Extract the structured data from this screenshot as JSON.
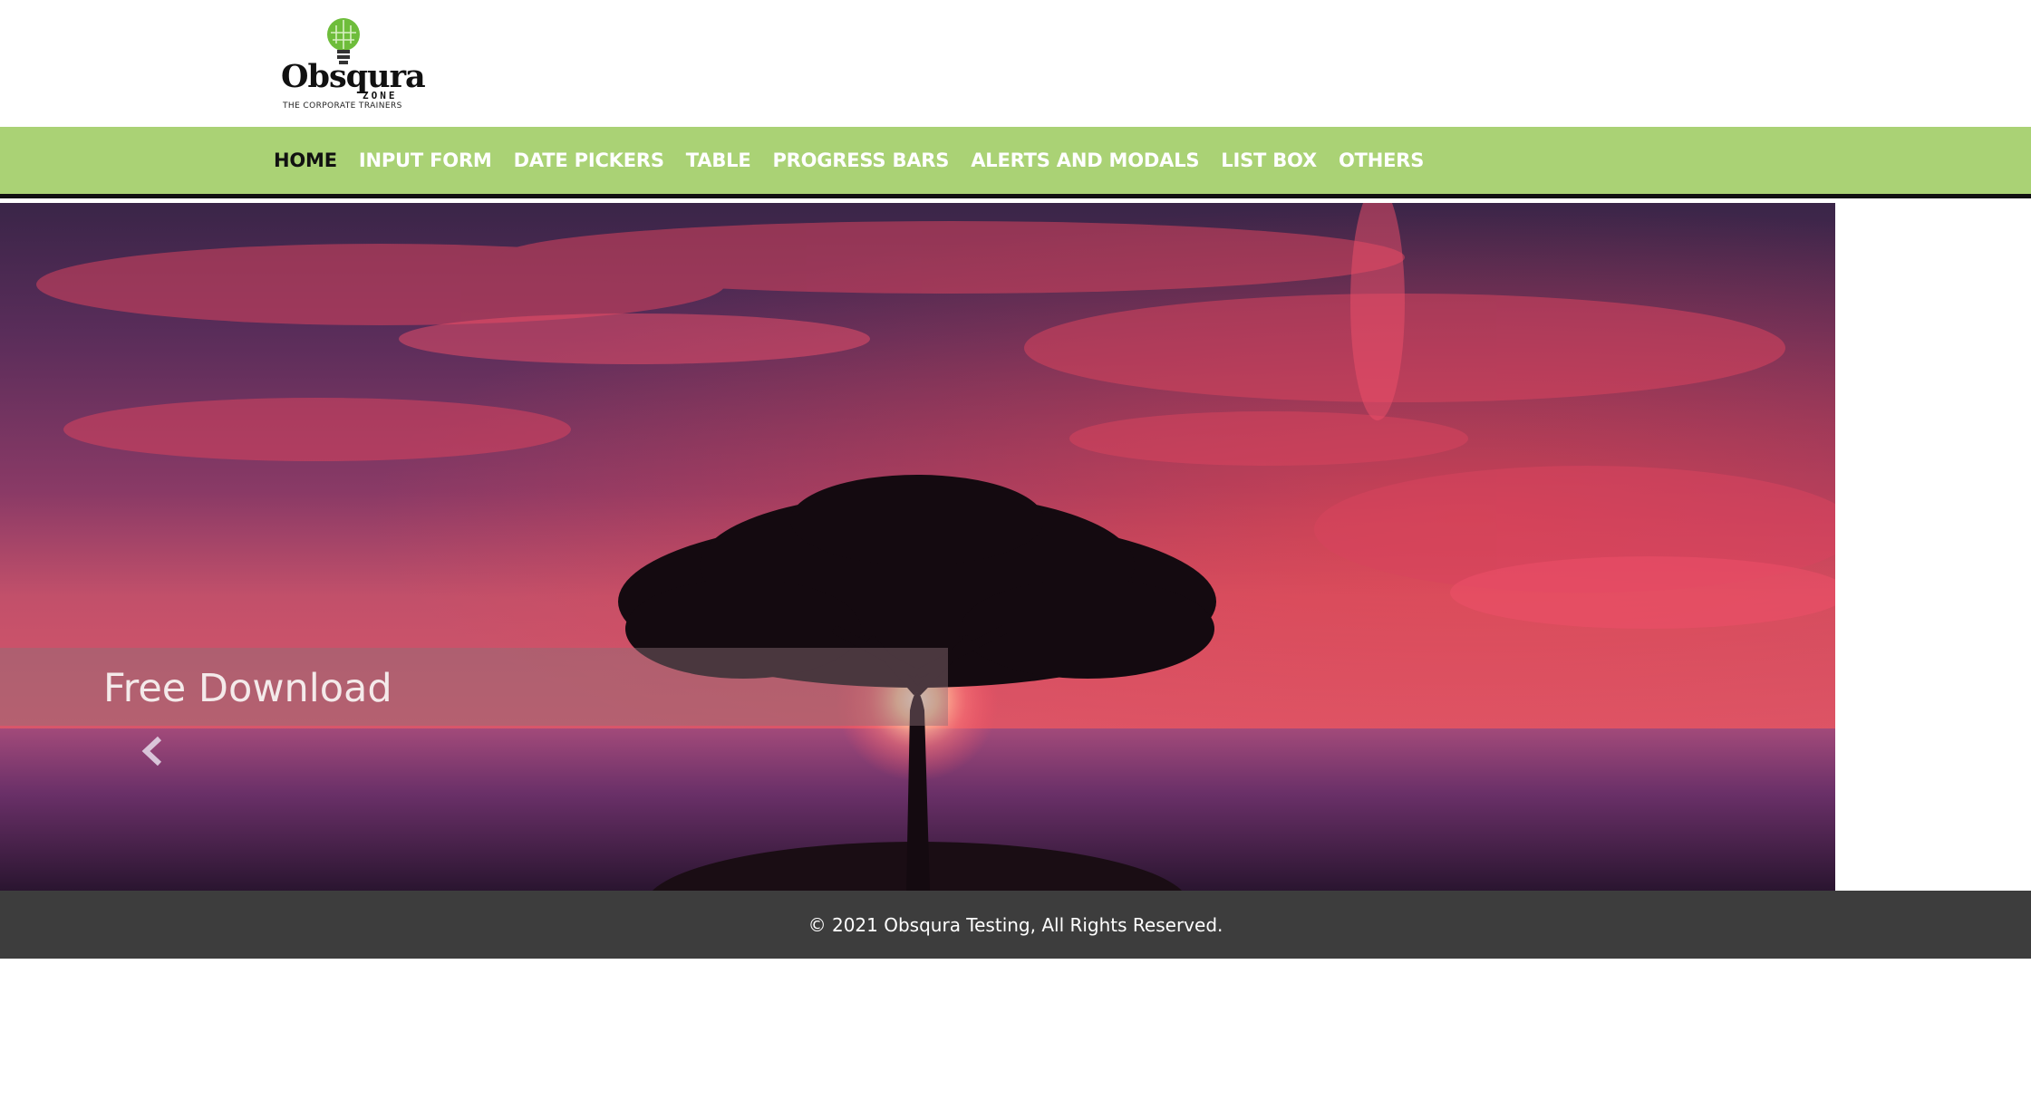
{
  "logo": {
    "brand": "Obsqura",
    "sub": "ZONE",
    "tagline": "THE CORPORATE TRAINERS"
  },
  "nav": {
    "items": [
      {
        "label": "HOME",
        "active": true
      },
      {
        "label": "INPUT FORM",
        "active": false
      },
      {
        "label": "DATE PICKERS",
        "active": false
      },
      {
        "label": "TABLE",
        "active": false
      },
      {
        "label": "PROGRESS BARS",
        "active": false
      },
      {
        "label": "ALERTS AND MODALS",
        "active": false
      },
      {
        "label": "LIST BOX",
        "active": false
      },
      {
        "label": "OTHERS",
        "active": false
      }
    ]
  },
  "carousel": {
    "caption": "Free Download",
    "prev_icon": "chevron-left-icon",
    "slide_count": 4,
    "active_slide": 1
  },
  "footer": {
    "text": "© 2021 Obsqura Testing, All Rights Reserved."
  },
  "colors": {
    "nav_bg": "#aad275",
    "nav_active": "#111111",
    "nav_text": "#ffffff",
    "footer_bg": "#3d3d3d",
    "logo_green": "#6ebd3b"
  }
}
